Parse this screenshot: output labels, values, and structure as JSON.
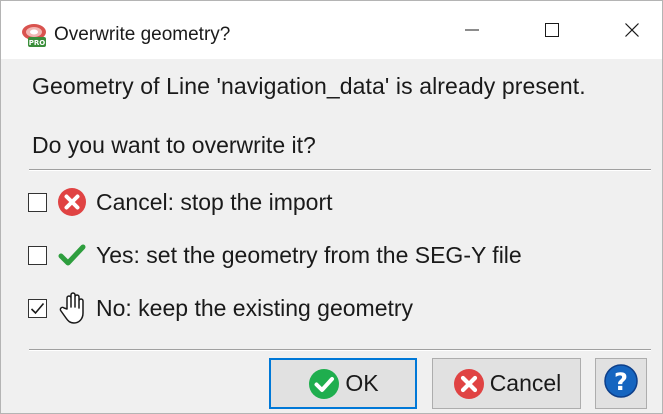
{
  "window": {
    "title": "Overwrite geometry?",
    "app_icon": "pro-app-icon",
    "controls": [
      "minimize-icon",
      "maximize-icon",
      "close-icon"
    ]
  },
  "message": "Geometry of Line 'navigation_data' is already present.",
  "question": "Do you want to overwrite it?",
  "options": [
    {
      "icon": "error-x-icon",
      "label": "Cancel: stop the import",
      "checked": false
    },
    {
      "icon": "checkmark-icon",
      "label": "Yes: set the geometry from the SEG-Y file",
      "checked": false
    },
    {
      "icon": "hand-stop-icon",
      "label": "No: keep the existing geometry",
      "checked": true
    }
  ],
  "buttons": {
    "ok_label": "OK",
    "cancel_label": "Cancel",
    "help_icon": "help-question-icon"
  },
  "colors": {
    "accent_focus": "#0078d7",
    "ok_green": "#1fae4e",
    "cancel_red": "#e04343",
    "help_blue": "#1565c0"
  }
}
